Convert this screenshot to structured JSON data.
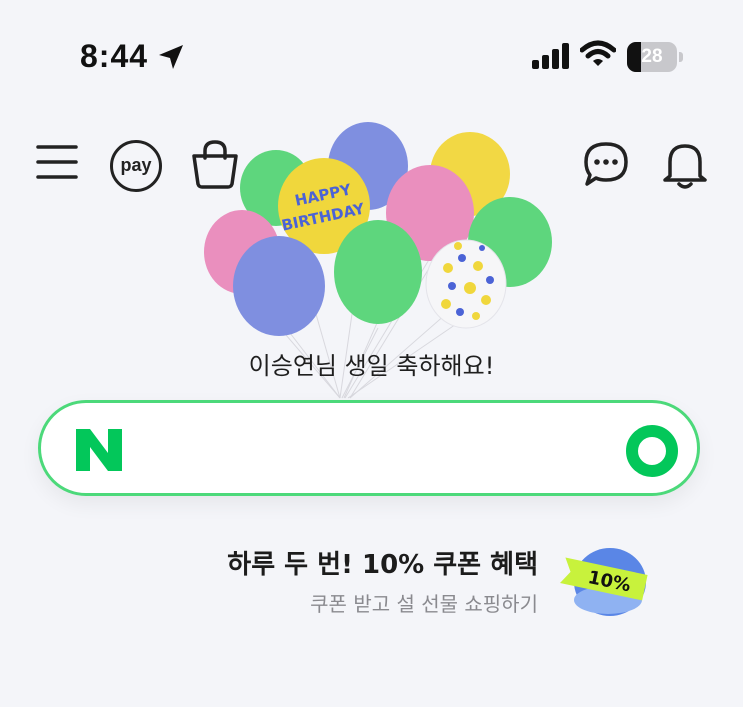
{
  "status_bar": {
    "time": "8:44",
    "battery_level": "28",
    "battery_fraction": 0.28,
    "icons": [
      "location-arrow-icon",
      "signal-icon",
      "wifi-icon",
      "battery-icon"
    ]
  },
  "nav": {
    "left_icons": [
      "menu-icon",
      "pay-icon",
      "shopping-bag-icon"
    ],
    "pay_label": "pay",
    "right_icons": [
      "chat-icon",
      "bell-icon"
    ]
  },
  "balloon_text": "HAPPY BIRTHDAY",
  "birthday_message": "이승연님 생일 축하해요!",
  "search": {
    "logo": "N",
    "value": "",
    "placeholder": "",
    "button_icon": "green-search-icon"
  },
  "promo": {
    "title": "하루 두 번! 10% 쿠폰 혜택",
    "subtitle": "쿠폰 받고 설 선물 쇼핑하기",
    "badge": "10%"
  },
  "colors": {
    "background": "#f4f5f9",
    "brand_green": "#03c75a",
    "search_border": "#4cd97a",
    "text_dark": "#1c1c1c",
    "text_muted": "#8a8a8f"
  }
}
